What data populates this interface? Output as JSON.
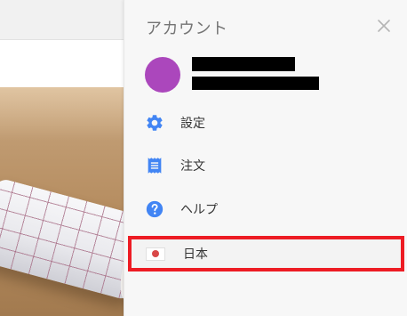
{
  "panel": {
    "title": "アカウント",
    "close_icon": "close-icon"
  },
  "user": {
    "avatar_color": "#ab47bc",
    "name_redacted_color": "#000000",
    "email_redacted_color": "#000000"
  },
  "menu": [
    {
      "icon": "gear-icon",
      "label": "設定"
    },
    {
      "icon": "receipt-icon",
      "label": "注文"
    },
    {
      "icon": "help-icon",
      "label": "ヘルプ"
    },
    {
      "icon": "japan-flag-icon",
      "label": "日本"
    }
  ],
  "colors": {
    "accent_blue": "#4285f4",
    "highlight_red": "#ed1c24",
    "flag_red": "#d94848"
  }
}
